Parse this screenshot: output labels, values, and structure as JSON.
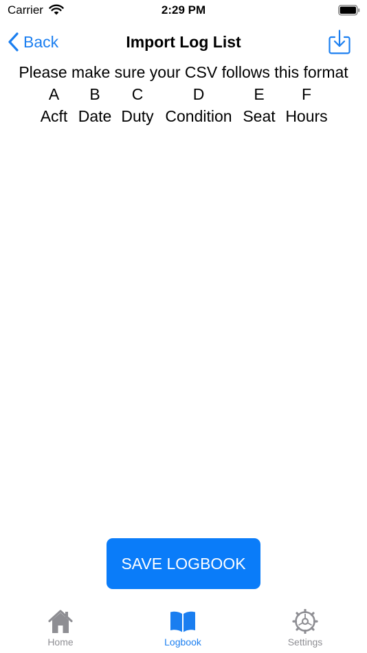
{
  "status_bar": {
    "carrier": "Carrier",
    "time": "2:29 PM"
  },
  "nav": {
    "back_label": "Back",
    "title": "Import Log List"
  },
  "content": {
    "instructions": "Please make sure your CSV follows this format",
    "columns": [
      {
        "letter": "A",
        "name": "Acft"
      },
      {
        "letter": "B",
        "name": "Date"
      },
      {
        "letter": "C",
        "name": "Duty"
      },
      {
        "letter": "D",
        "name": "Condition"
      },
      {
        "letter": "E",
        "name": "Seat"
      },
      {
        "letter": "F",
        "name": "Hours"
      }
    ]
  },
  "save_button": {
    "label": "SAVE LOGBOOK"
  },
  "tab_bar": {
    "tabs": [
      {
        "label": "Home",
        "icon": "house-icon"
      },
      {
        "label": "Logbook",
        "icon": "book-icon"
      },
      {
        "label": "Settings",
        "icon": "gear-icon"
      }
    ],
    "selected": "Logbook"
  },
  "colors": {
    "accent": "#1a7ef0",
    "button": "#0a7cf9",
    "tab_inactive": "#8e8e93"
  }
}
